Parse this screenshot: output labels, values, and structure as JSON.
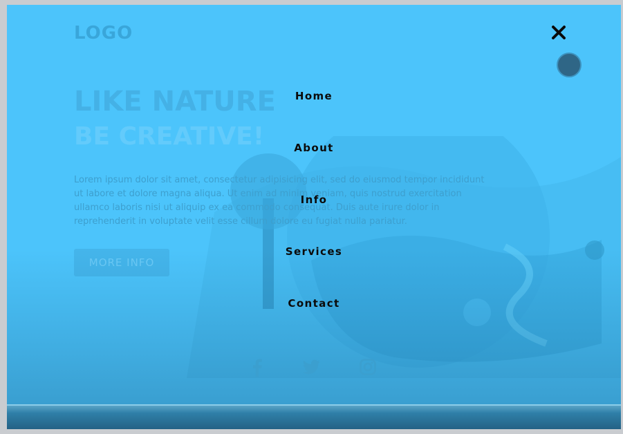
{
  "background_page": {
    "logo": "LOGO",
    "hero_line_1": "LIKE NATURE",
    "hero_line_2": "BE CREATIVE!",
    "paragraph_lines": [
      "Lorem ipsum dolor sit amet, consectetur adipisicing elit, sed do eiusmod tempor incididunt",
      "ut labore et dolore magna aliqua. Ut enim ad minim veniam, quis nostrud exercitation",
      "ullamco laboris nisi ut aliquip ex ea commodo consequat. Duis aute irure dolor in",
      "reprehenderit in voluptate velit esse cillum dolore eu fugiat nulla pariatur."
    ],
    "button_label": "MORE INFO"
  },
  "nav": {
    "items": [
      {
        "label": "Home"
      },
      {
        "label": "About"
      },
      {
        "label": "Info"
      },
      {
        "label": "Services"
      },
      {
        "label": "Contact"
      }
    ],
    "close_icon": "close-icon"
  },
  "social": [
    "facebook-icon",
    "twitter-icon",
    "instagram-icon"
  ],
  "colors": {
    "overlay": "#4cc4fb",
    "menu_text": "#0b0b0b",
    "bottom_bar": "#235f82"
  }
}
